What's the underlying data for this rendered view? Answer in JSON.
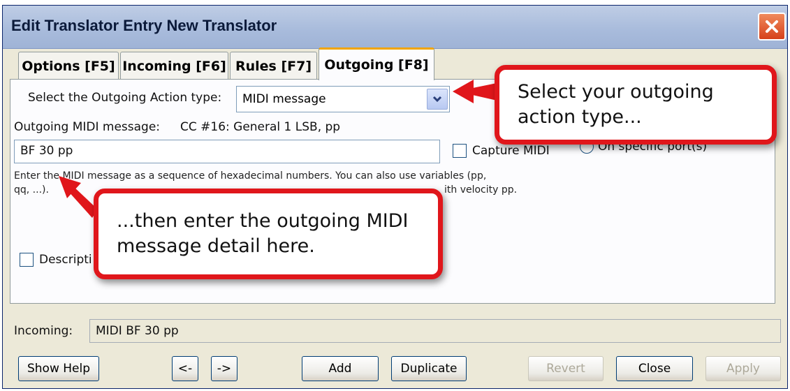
{
  "window": {
    "title": "Edit Translator Entry New Translator"
  },
  "tabs": [
    {
      "label": "Options [F5]",
      "active": false
    },
    {
      "label": "Incoming [F6]",
      "active": false
    },
    {
      "label": "Rules [F7]",
      "active": false
    },
    {
      "label": "Outgoing [F8]",
      "active": true
    }
  ],
  "outgoing": {
    "action_type_label": "Select the Outgoing Action type:",
    "action_type_value": "MIDI message",
    "midi_message_label": "Outgoing MIDI message:",
    "midi_message_desc": "CC #16: General 1 LSB, pp",
    "midi_message_value": "BF 30 pp",
    "capture_midi_label": "Capture MIDI",
    "port_option_label": "On specific port(s)",
    "help_line1": "Enter the MIDI message as a sequence of hexadecimal numbers. You can also use variables (pp,",
    "help_line2_start": "qq, ...).",
    "help_line2_end": "ith velocity pp.",
    "description_label": "Descripti"
  },
  "incoming": {
    "label": "Incoming:",
    "value": "MIDI BF 30 pp"
  },
  "buttons": {
    "show_help": "Show Help",
    "prev": "<-",
    "next": "->",
    "add": "Add",
    "duplicate": "Duplicate",
    "revert": "Revert",
    "close": "Close",
    "apply": "Apply"
  },
  "callouts": {
    "top": "Select your outgoing action type...",
    "bottom": "...then enter the outgoing MIDI message detail here."
  },
  "colors": {
    "callout_border": "#e0161b",
    "active_tab_accent": "#f2a500",
    "close_button": "#d6411a"
  }
}
